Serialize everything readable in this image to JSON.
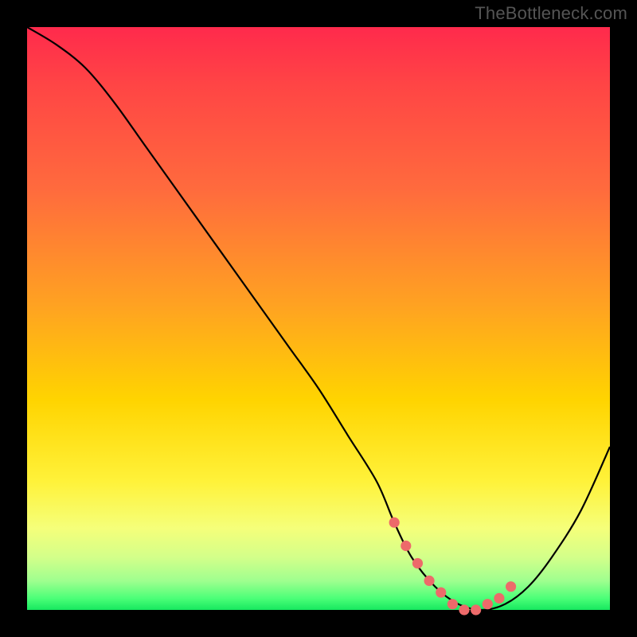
{
  "watermark": "TheBottleneck.com",
  "chart_data": {
    "type": "line",
    "title": "",
    "xlabel": "",
    "ylabel": "",
    "xlim": [
      0,
      100
    ],
    "ylim": [
      0,
      100
    ],
    "series": [
      {
        "name": "bottleneck-curve",
        "x": [
          0,
          5,
          10,
          15,
          20,
          25,
          30,
          35,
          40,
          45,
          50,
          55,
          60,
          63,
          66,
          70,
          74,
          78,
          82,
          86,
          90,
          95,
          100
        ],
        "values": [
          100,
          97,
          93,
          87,
          80,
          73,
          66,
          59,
          52,
          45,
          38,
          30,
          22,
          15,
          9,
          4,
          1,
          0,
          1,
          4,
          9,
          17,
          28
        ]
      }
    ],
    "highlight_segment": {
      "name": "minimum-region-dots",
      "x": [
        63,
        65,
        67,
        69,
        71,
        73,
        75,
        77,
        79,
        81,
        83
      ],
      "values": [
        15,
        11,
        8,
        5,
        3,
        1,
        0,
        0,
        1,
        2,
        4
      ],
      "color": "#ed6a6a"
    },
    "gradient_stops": [
      {
        "pos": 0,
        "color": "#ff2a4c"
      },
      {
        "pos": 10,
        "color": "#ff4545"
      },
      {
        "pos": 28,
        "color": "#ff6b3d"
      },
      {
        "pos": 48,
        "color": "#ffa321"
      },
      {
        "pos": 64,
        "color": "#ffd400"
      },
      {
        "pos": 78,
        "color": "#fff23a"
      },
      {
        "pos": 86,
        "color": "#f5ff7a"
      },
      {
        "pos": 91,
        "color": "#d3ff8a"
      },
      {
        "pos": 95,
        "color": "#9fff8f"
      },
      {
        "pos": 98,
        "color": "#4cff78"
      },
      {
        "pos": 100,
        "color": "#17e85f"
      }
    ]
  }
}
